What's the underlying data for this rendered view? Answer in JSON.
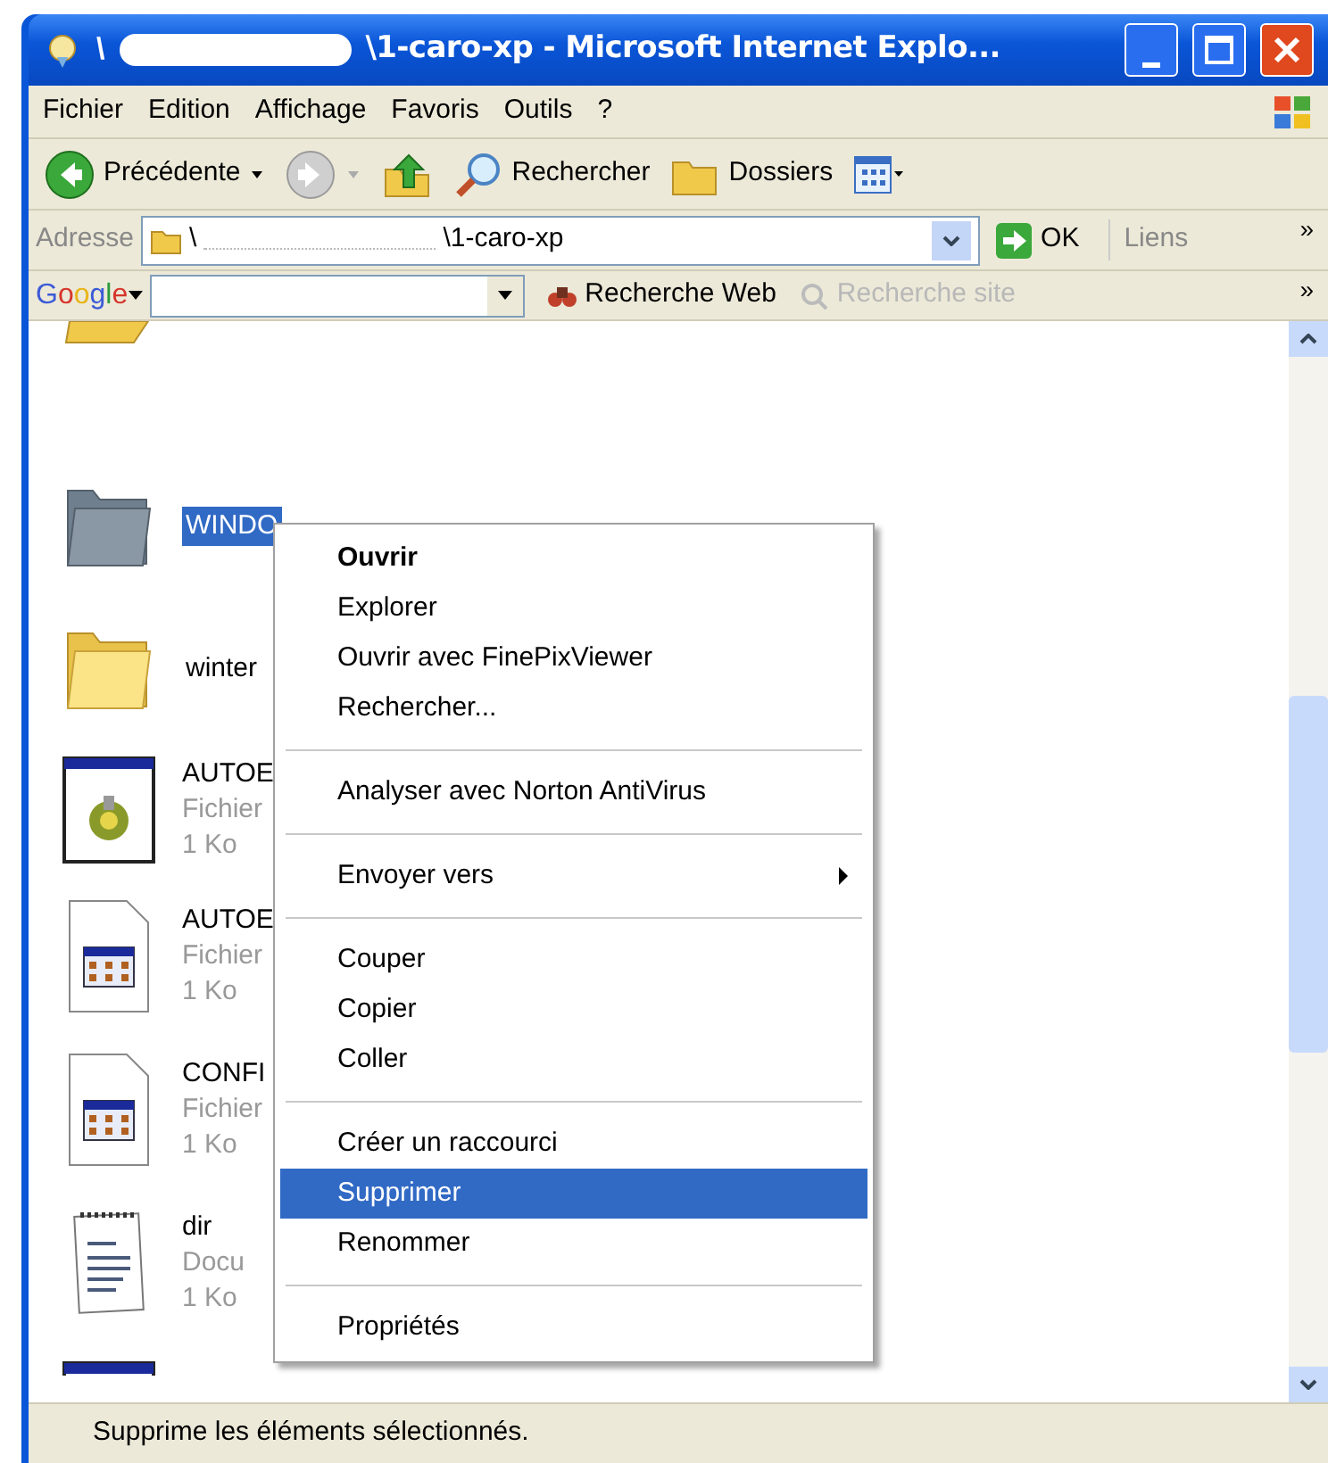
{
  "window": {
    "title_prefix": "\\",
    "title": "\\1-caro-xp - Microsoft Internet Explo..."
  },
  "menu_bar": [
    "Fichier",
    "Edition",
    "Affichage",
    "Favoris",
    "Outils",
    "?"
  ],
  "toolbar": [
    {
      "kind": "back",
      "label": "Précédente"
    },
    {
      "kind": "forward"
    },
    {
      "kind": "up"
    },
    {
      "kind": "search",
      "label": "Rechercher"
    },
    {
      "kind": "folders",
      "label": "Dossiers"
    },
    {
      "kind": "views"
    }
  ],
  "address": {
    "label": "Adresse",
    "prefix": "\\",
    "value": "\\1-caro-xp",
    "go": "OK",
    "links": "Liens",
    "more": "»"
  },
  "google": {
    "logo": "Google",
    "buttons": [
      {
        "label": "Recherche Web",
        "disabled": false
      },
      {
        "label": "Recherche site",
        "disabled": true
      }
    ],
    "more": "»"
  },
  "files": [
    {
      "kind": "folder-cut"
    },
    {
      "kind": "folder-grey",
      "name": "WINDO",
      "selected": true
    },
    {
      "kind": "folder",
      "name": "winter",
      "selected": false
    },
    {
      "kind": "app",
      "name": "AUTOE",
      "type": "Fichier",
      "size": "1 Ko",
      "selected": false
    },
    {
      "kind": "sheet",
      "name": "AUTOE",
      "type": "Fichier",
      "size": "1 Ko",
      "selected": false
    },
    {
      "kind": "sheet",
      "name": "CONFI",
      "type": "Fichier",
      "size": "1 Ko",
      "selected": false
    },
    {
      "kind": "note",
      "name": "dir",
      "type": "Docu",
      "size": "1 Ko",
      "selected": false
    },
    {
      "kind": "app-cut"
    }
  ],
  "context_menu": [
    {
      "kind": "item",
      "label": "Ouvrir",
      "default": true,
      "selected": false
    },
    {
      "kind": "item",
      "label": "Explorer",
      "default": false,
      "selected": false
    },
    {
      "kind": "item",
      "label": "Ouvrir avec FinePixViewer",
      "default": false,
      "selected": false
    },
    {
      "kind": "item",
      "label": "Rechercher...",
      "default": false,
      "selected": false
    },
    {
      "kind": "separator"
    },
    {
      "kind": "item",
      "label": "Analyser avec Norton AntiVirus",
      "default": false,
      "selected": false
    },
    {
      "kind": "separator"
    },
    {
      "kind": "submenu",
      "label": "Envoyer vers",
      "default": false,
      "selected": false
    },
    {
      "kind": "separator"
    },
    {
      "kind": "item",
      "label": "Couper",
      "default": false,
      "selected": false
    },
    {
      "kind": "item",
      "label": "Copier",
      "default": false,
      "selected": false
    },
    {
      "kind": "item",
      "label": "Coller",
      "default": false,
      "selected": false
    },
    {
      "kind": "separator"
    },
    {
      "kind": "item",
      "label": "Créer un raccourci",
      "default": false,
      "selected": false
    },
    {
      "kind": "item",
      "label": "Supprimer",
      "default": false,
      "selected": true
    },
    {
      "kind": "item",
      "label": "Renommer",
      "default": false,
      "selected": false
    },
    {
      "kind": "separator"
    },
    {
      "kind": "item",
      "label": "Propriétés",
      "default": false,
      "selected": false
    }
  ],
  "status_bar": "Supprime les éléments sélectionnés."
}
